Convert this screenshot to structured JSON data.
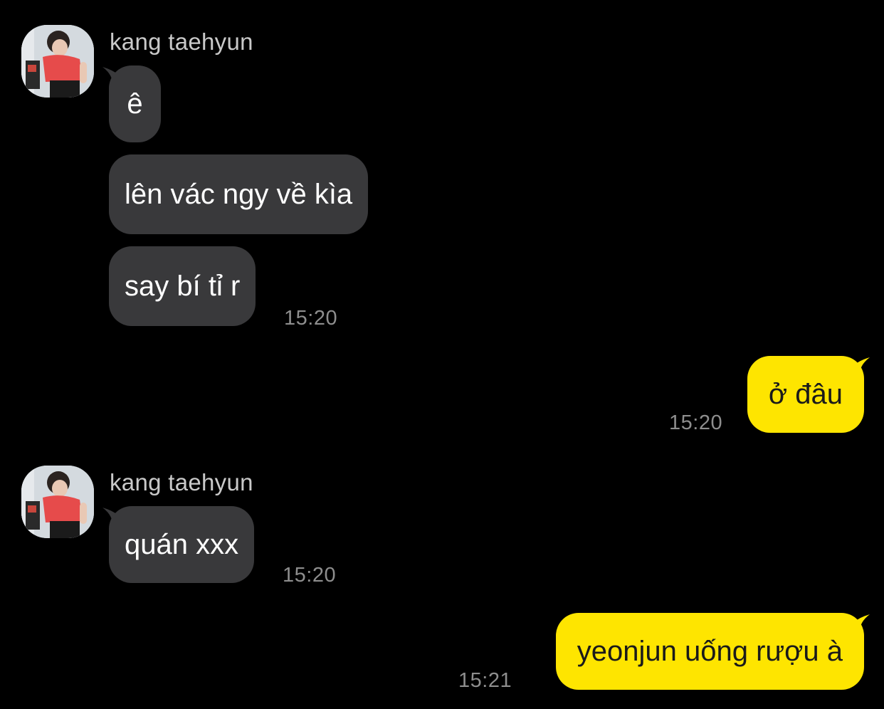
{
  "conversation": {
    "groups": [
      {
        "sender": "kang taehyun",
        "messages": [
          "ê",
          "lên vác ngy về kìa",
          "say bí tỉ r"
        ],
        "time": "15:20"
      },
      {
        "outgoing": true,
        "messages": [
          "ở đâu"
        ],
        "time": "15:20"
      },
      {
        "sender": "kang taehyun",
        "messages": [
          "quán xxx"
        ],
        "time": "15:20"
      },
      {
        "outgoing": true,
        "messages": [
          "yeonjun uống rượu à"
        ],
        "time": "15:21"
      }
    ]
  },
  "colors": {
    "background": "#000000",
    "incoming_bubble": "#39393b",
    "outgoing_bubble": "#fee500",
    "timestamp": "#8e8e8e",
    "sender_name": "#c9c9c9"
  }
}
